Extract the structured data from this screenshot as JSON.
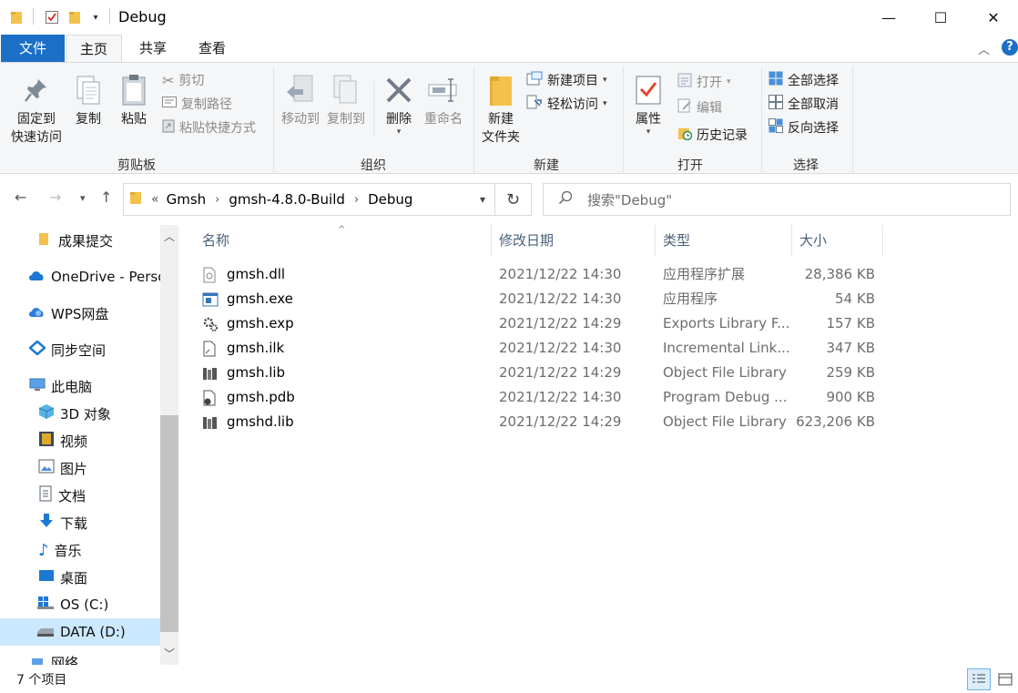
{
  "window": {
    "title": "Debug",
    "minimize_icon": "—",
    "maximize_icon": "☐",
    "close_icon": "✕"
  },
  "ribbon_tabs": {
    "file": "文件",
    "home": "主页",
    "share": "共享",
    "view": "查看"
  },
  "ribbon": {
    "clipboard": {
      "pin_line1": "固定到",
      "pin_line2": "快速访问",
      "copy": "复制",
      "paste": "粘贴",
      "cut": "剪切",
      "copy_path": "复制路径",
      "paste_shortcut": "粘贴快捷方式",
      "label": "剪贴板"
    },
    "organize": {
      "move_to": "移动到",
      "copy_to": "复制到",
      "delete": "删除",
      "rename": "重命名",
      "label": "组织"
    },
    "new": {
      "new_folder_line1": "新建",
      "new_folder_line2": "文件夹",
      "new_item": "新建项目",
      "easy_access": "轻松访问",
      "label": "新建"
    },
    "open": {
      "properties": "属性",
      "open": "打开",
      "edit": "编辑",
      "history": "历史记录",
      "label": "打开"
    },
    "select": {
      "select_all": "全部选择",
      "select_none": "全部取消",
      "invert": "反向选择",
      "label": "选择"
    }
  },
  "address": {
    "prefix": "«",
    "crumbs": [
      "Gmsh",
      "gmsh-4.8.0-Build",
      "Debug"
    ],
    "search_placeholder": "搜索\"Debug\""
  },
  "nav": {
    "items": [
      "成果提交",
      "OneDrive - Perso",
      "WPS网盘",
      "同步空间",
      "此电脑",
      "3D 对象",
      "视频",
      "图片",
      "文档",
      "下载",
      "音乐",
      "桌面",
      "OS (C:)",
      "DATA (D:)",
      "网络"
    ]
  },
  "columns": {
    "name": "名称",
    "date": "修改日期",
    "type": "类型",
    "size": "大小"
  },
  "files": [
    {
      "name": "gmsh.dll",
      "date": "2021/12/22 14:30",
      "type": "应用程序扩展",
      "size": "28,386 KB",
      "icon": "dll-icon"
    },
    {
      "name": "gmsh.exe",
      "date": "2021/12/22 14:30",
      "type": "应用程序",
      "size": "54 KB",
      "icon": "exe-icon"
    },
    {
      "name": "gmsh.exp",
      "date": "2021/12/22 14:29",
      "type": "Exports Library F...",
      "size": "157 KB",
      "icon": "exp-icon"
    },
    {
      "name": "gmsh.ilk",
      "date": "2021/12/22 14:30",
      "type": "Incremental Link...",
      "size": "347 KB",
      "icon": "ilk-icon"
    },
    {
      "name": "gmsh.lib",
      "date": "2021/12/22 14:29",
      "type": "Object File Library",
      "size": "259 KB",
      "icon": "lib-icon"
    },
    {
      "name": "gmsh.pdb",
      "date": "2021/12/22 14:30",
      "type": "Program Debug ...",
      "size": "900 KB",
      "icon": "pdb-icon"
    },
    {
      "name": "gmshd.lib",
      "date": "2021/12/22 14:29",
      "type": "Object File Library",
      "size": "623,206 KB",
      "icon": "lib-icon"
    }
  ],
  "status": {
    "count": "7 个项目"
  },
  "colors": {
    "file_tab": "#1b6fc7",
    "selected": "#cce8ff",
    "folder": "#f3c24c",
    "help": "#1b6fc7"
  }
}
